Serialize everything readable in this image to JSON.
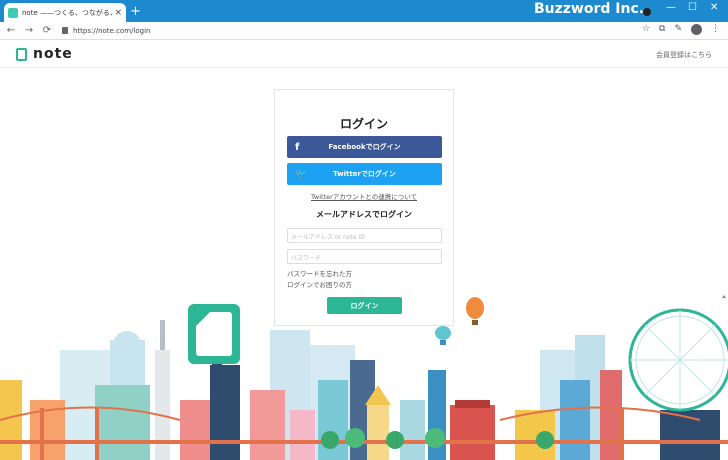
{
  "browser": {
    "tab_title": "note ——つくる、つながる、とどける。",
    "tab_close": "×",
    "new_tab": "+",
    "url": "https://note.com/login",
    "watermark": "Buzzword Inc.",
    "window_controls": [
      "—",
      "☐",
      "✕"
    ],
    "nav": [
      "←",
      "→",
      "⟳"
    ],
    "tools": [
      "☆",
      "⧉",
      "✎",
      "⋮"
    ]
  },
  "header": {
    "logo": "note",
    "signup_link": "会員登録はこちら"
  },
  "login": {
    "title": "ログイン",
    "facebook_button": "Facebookでログイン",
    "facebook_icon": "f",
    "twitter_button": "Twitterでログイン",
    "twitter_icon": "🐦",
    "twitter_link": "Twitterアカウントとの連携について",
    "email_heading": "メールアドレスでログイン",
    "email_placeholder": "メールアドレス or note ID",
    "password_placeholder": "パスワード",
    "forgot_password": "パスワードを忘れた方",
    "trouble_link": "ログインでお困りの方",
    "submit": "ログイン"
  },
  "colors": {
    "brand": "#2cb696",
    "facebook": "#3b5998",
    "twitter": "#1da1f2",
    "chrome": "#1d8ad0"
  }
}
